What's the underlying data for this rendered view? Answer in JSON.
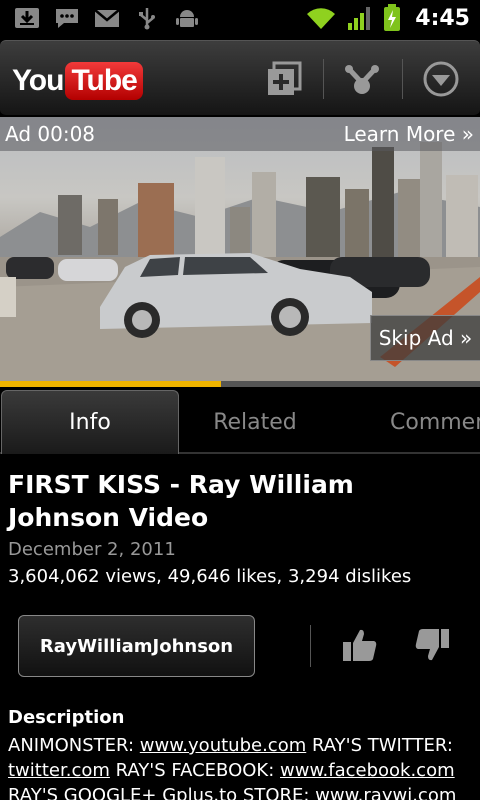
{
  "status_bar": {
    "time": "4:45",
    "left_icons": [
      "download-icon",
      "chat-icon",
      "gmail-icon",
      "usb-icon",
      "android-debug-icon"
    ],
    "right_icons": [
      "wifi-icon",
      "signal-icon",
      "battery-charging-icon"
    ]
  },
  "action_bar": {
    "logo_you": "You",
    "logo_tube": "Tube",
    "buttons": [
      "add-to-playlist-icon",
      "share-icon",
      "more-menu-icon"
    ]
  },
  "video": {
    "ad_timer": "Ad 00:08",
    "learn_more": "Learn More »",
    "skip_ad": "Skip Ad »",
    "progress": 0.46
  },
  "tabs": [
    {
      "label": "Info",
      "active": true
    },
    {
      "label": "Related",
      "active": false
    },
    {
      "label": "Comments",
      "active": false
    }
  ],
  "info": {
    "title": "FIRST KISS - Ray William Johnson Video",
    "date": "December 2, 2011",
    "stats": "3,604,062 views, 49,646 likes, 3,294 dislikes",
    "channel": "RayWilliamJohnson",
    "description_heading": "Description",
    "description": {
      "t1": "ANIMONSTER: ",
      "l1": "www.youtube.com",
      "t2": " RAY'S TWITTER: ",
      "l2": "twitter.com",
      "t3": " RAY'S FACEBOOK: ",
      "l3": "www.facebook.com",
      "t4": " RAY'S GOOGLE+ Gplus.to STORE: ",
      "l4": "www.raywj.com"
    }
  },
  "colors": {
    "progress": "#f0b400",
    "wifi": "#8fd11f",
    "battery": "#7fc31c",
    "youtube_red": "#cc0000"
  }
}
